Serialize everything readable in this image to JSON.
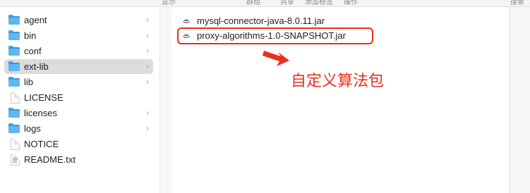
{
  "toolbar": {
    "items": [
      "显示",
      "群组",
      "共享",
      "添加标签",
      "操作",
      "搜索"
    ]
  },
  "sidebar": {
    "items": [
      {
        "label": "agent",
        "kind": "folder",
        "chevron": "›"
      },
      {
        "label": "bin",
        "kind": "folder",
        "chevron": "›"
      },
      {
        "label": "conf",
        "kind": "folder",
        "chevron": "›"
      },
      {
        "label": "ext-lib",
        "kind": "folder",
        "chevron": "›",
        "selected": true
      },
      {
        "label": "lib",
        "kind": "folder",
        "chevron": "›"
      },
      {
        "label": "LICENSE",
        "kind": "file"
      },
      {
        "label": "licenses",
        "kind": "folder",
        "chevron": "›"
      },
      {
        "label": "logs",
        "kind": "folder",
        "chevron": "›"
      },
      {
        "label": "NOTICE",
        "kind": "file"
      },
      {
        "label": "README.txt",
        "kind": "text-file"
      }
    ]
  },
  "files": [
    {
      "name": "mysql-connector-java-8.0.11.jar",
      "icon": "jar-icon"
    },
    {
      "name": "proxy-algorithms-1.0-SNAPSHOT.jar",
      "icon": "jar-icon",
      "highlighted": true
    }
  ],
  "annotation": {
    "text": "自定义算法包",
    "color": "#e8301f"
  },
  "colors": {
    "selection": "#dcdcdc",
    "folder": "#3b97dd",
    "annotation": "#e8301f"
  }
}
